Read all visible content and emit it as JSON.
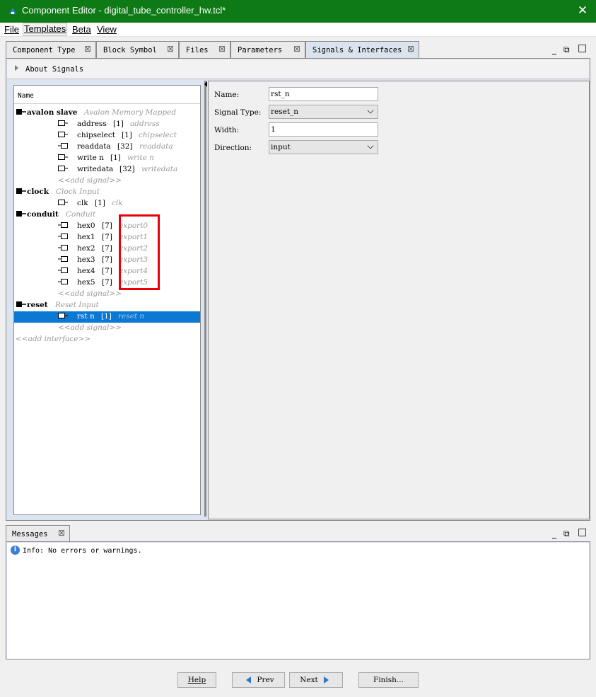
{
  "window": {
    "title": "Component Editor - digital_tube_controller_hw.tcl*",
    "close_glyph": "✕"
  },
  "menu": [
    "File",
    "Templates",
    "Beta",
    "View"
  ],
  "tabs": [
    {
      "label": "Component Type",
      "close": "⊠"
    },
    {
      "label": "Block Symbol",
      "close": "⊠"
    },
    {
      "label": "Files",
      "close": "⊠"
    },
    {
      "label": "Parameters",
      "close": "⊠"
    },
    {
      "label": "Signals & Interfaces",
      "close": "⊠"
    }
  ],
  "window_controls": {
    "minimize": "_",
    "restore": "⧉",
    "maximize": "□"
  },
  "about": {
    "label": "About Signals"
  },
  "tree": {
    "header": "Name",
    "rows": [
      {
        "kind": "interface",
        "name": "avalon slave",
        "meta": "Avalon  Memory  Mapped"
      },
      {
        "kind": "signal",
        "icon": "in",
        "name": "address",
        "width": "[1]",
        "type": "address"
      },
      {
        "kind": "signal",
        "icon": "in",
        "name": "chipselect",
        "width": "[1]",
        "type": "chipselect"
      },
      {
        "kind": "signal",
        "icon": "out",
        "name": "readdata",
        "width": "[32]",
        "type": "readdata"
      },
      {
        "kind": "signal",
        "icon": "in",
        "name": "write n",
        "width": "[1]",
        "type": "write n"
      },
      {
        "kind": "signal",
        "icon": "in",
        "name": "writedata",
        "width": "[32]",
        "type": "writedata"
      },
      {
        "kind": "add",
        "name": "<<add  signal>>"
      },
      {
        "kind": "interface",
        "name": "clock",
        "meta": "Clock  Input"
      },
      {
        "kind": "signal",
        "icon": "in",
        "name": "clk",
        "width": "[1]",
        "type": "clk"
      },
      {
        "kind": "interface",
        "name": "conduit",
        "meta": "Conduit"
      },
      {
        "kind": "signal",
        "icon": "out",
        "name": "hex0",
        "width": "[7]",
        "type": "export0"
      },
      {
        "kind": "signal",
        "icon": "out",
        "name": "hex1",
        "width": "[7]",
        "type": "export1"
      },
      {
        "kind": "signal",
        "icon": "out",
        "name": "hex2",
        "width": "[7]",
        "type": "export2"
      },
      {
        "kind": "signal",
        "icon": "out",
        "name": "hex3",
        "width": "[7]",
        "type": "export3"
      },
      {
        "kind": "signal",
        "icon": "out",
        "name": "hex4",
        "width": "[7]",
        "type": "export4"
      },
      {
        "kind": "signal",
        "icon": "out",
        "name": "hex5",
        "width": "[7]",
        "type": "export5"
      },
      {
        "kind": "add",
        "name": "<<add  signal>>"
      },
      {
        "kind": "interface",
        "name": "reset",
        "meta": "Reset  Input"
      },
      {
        "kind": "signal",
        "icon": "in",
        "name": "rst n",
        "width": "[1]",
        "type": "reset n",
        "selected": true
      },
      {
        "kind": "add",
        "name": "<<add  signal>>"
      },
      {
        "kind": "add_interface",
        "name": "<<add  interface>>"
      }
    ]
  },
  "form": {
    "name_label": "Name:",
    "name_value": "rst_n",
    "signal_type_label": "Signal Type:",
    "signal_type_value": "reset_n",
    "width_label": "Width:",
    "width_value": "1",
    "direction_label": "Direction:",
    "direction_value": "input"
  },
  "messages": {
    "tab_label": "Messages",
    "tab_close": "⊠",
    "info_icon": "i",
    "info_text": "Info: No errors or warnings."
  },
  "buttons": {
    "help": "Help",
    "prev": "Prev",
    "next": "Next",
    "finish": "Finish..."
  },
  "colors": {
    "titlebar": "#0e7a16",
    "selection": "#0b78d4",
    "highlight_box": "#e8000b"
  }
}
